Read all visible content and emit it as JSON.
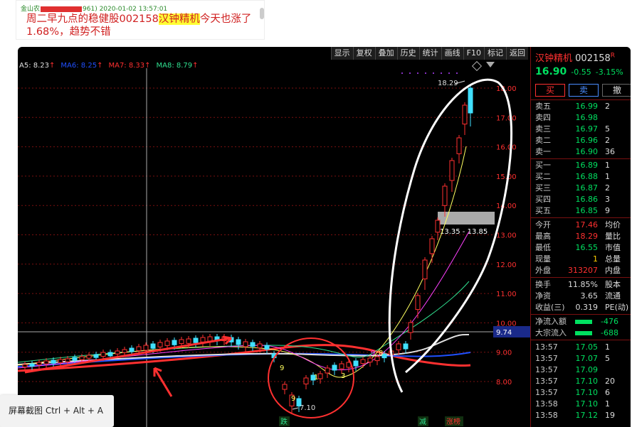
{
  "post": {
    "meta_prefix": "金山农",
    "meta_suffix": "961) 2020-01-02 13:57:01",
    "text_before": "周二早九点的稳健股002158",
    "text_highlight": "汉钟精机",
    "text_after": "今天也涨了1.68%，趋势不错"
  },
  "toolbar": [
    "显示",
    "复权",
    "叠加",
    "历史",
    "统计",
    "画线",
    "F10",
    "标记",
    "返回"
  ],
  "ma_legend": [
    {
      "label": "A5: 8.23",
      "arrow": "↑",
      "color": "#e0e0e0"
    },
    {
      "label": "MA6: 8.25",
      "arrow": "↑",
      "color": "#2050ff"
    },
    {
      "label": "MA7: 8.33",
      "arrow": "↑",
      "color": "#ff3030"
    },
    {
      "label": "MA8: 8.79",
      "arrow": "↑",
      "color": "#30e090"
    }
  ],
  "chart": {
    "y_ticks": [
      "18.00",
      "17.00",
      "16.00",
      "15.00",
      "14.00",
      "13.00",
      "12.00",
      "11.00",
      "10.00",
      "9.00",
      "8.00"
    ],
    "high_label": "18.29",
    "low_label": "7.10",
    "range_label": "13.35 - 13.85",
    "crosshair_label": "9.74",
    "bottom_marks": [
      "跌",
      "减",
      "涨榜"
    ],
    "digit_labels": [
      "9",
      "8",
      "9",
      "1",
      "9",
      "3"
    ]
  },
  "stock": {
    "name": "汉钟精机",
    "code": "002158",
    "flag": "R",
    "price": "16.90",
    "change": "-0.55",
    "pct": "-3.15%",
    "btn_buy": "买",
    "btn_sell": "卖",
    "btn_cancel": "撤",
    "asks": [
      {
        "label": "卖五",
        "price": "16.99",
        "vol": "2"
      },
      {
        "label": "卖四",
        "price": "16.98",
        "vol": ""
      },
      {
        "label": "卖三",
        "price": "16.97",
        "vol": "5"
      },
      {
        "label": "卖二",
        "price": "16.96",
        "vol": "2"
      },
      {
        "label": "卖一",
        "price": "16.90",
        "vol": "36"
      }
    ],
    "bids": [
      {
        "label": "买一",
        "price": "16.89",
        "vol": "1"
      },
      {
        "label": "买二",
        "price": "16.88",
        "vol": "1"
      },
      {
        "label": "买三",
        "price": "16.87",
        "vol": "2"
      },
      {
        "label": "买四",
        "price": "16.86",
        "vol": "3"
      },
      {
        "label": "买五",
        "price": "16.85",
        "vol": "9"
      }
    ],
    "stats": [
      {
        "label": "今开",
        "value": "17.46",
        "extra": "均价",
        "color": "#ff3030"
      },
      {
        "label": "最高",
        "value": "18.29",
        "extra": "量比",
        "color": "#ff3030"
      },
      {
        "label": "最低",
        "value": "16.55",
        "extra": "市值",
        "color": "#00e060"
      },
      {
        "label": "现量",
        "value": "1",
        "extra": "总量",
        "color": "#ffd000"
      },
      {
        "label": "外盘",
        "value": "313207",
        "extra": "内盘",
        "color": "#ff3030"
      }
    ],
    "stats2": [
      {
        "label": "换手",
        "value": "11.85%",
        "extra": "股本",
        "color": "#ddd"
      },
      {
        "label": "净资",
        "value": "3.65",
        "extra": "流通",
        "color": "#ddd"
      },
      {
        "label": "收益(三)",
        "value": "0.319",
        "extra": "PE(动)",
        "color": "#ddd"
      }
    ],
    "flows": [
      {
        "label": "净流入额",
        "value": "-476"
      },
      {
        "label": "大宗流入",
        "value": "-688"
      }
    ],
    "ticks": [
      {
        "time": "13:57",
        "price": "17.05",
        "vol": "1"
      },
      {
        "time": "13:57",
        "price": "17.07",
        "vol": "5"
      },
      {
        "time": "13:57",
        "price": "17.09",
        "vol": ""
      },
      {
        "time": "13:57",
        "price": "17.10",
        "vol": "20"
      },
      {
        "time": "13:57",
        "price": "17.10",
        "vol": "6"
      },
      {
        "time": "13:58",
        "price": "17.10",
        "vol": "1"
      },
      {
        "time": "13:58",
        "price": "17.12",
        "vol": "19"
      }
    ]
  },
  "watermark": "屏幕截图 Ctrl + Alt + A"
}
